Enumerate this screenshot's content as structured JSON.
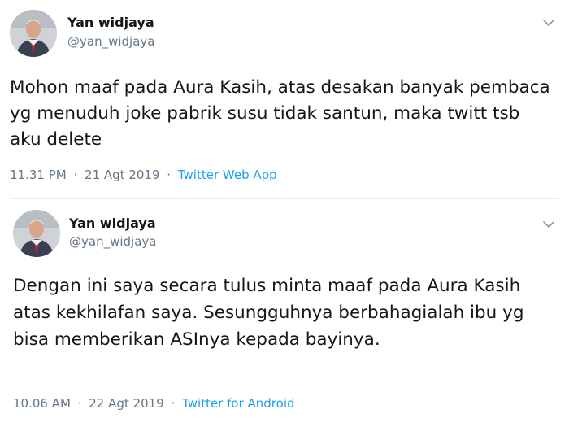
{
  "tweets": [
    {
      "author": {
        "display_name": "Yan widjaya",
        "handle": "@yan_widjaya",
        "avatar_icon": "avatar"
      },
      "menu_icon": "chevron-down-icon",
      "text": "Mohon maaf pada Aura Kasih, atas desakan banyak pembaca yg menuduh joke pabrik susu tidak santun, maka twitt tsb aku delete",
      "time": "11.31 PM",
      "date": "21 Agt 2019",
      "separator": "·",
      "source": "Twitter Web App"
    },
    {
      "author": {
        "display_name": "Yan widjaya",
        "handle": "@yan_widjaya",
        "avatar_icon": "avatar"
      },
      "menu_icon": "chevron-down-icon",
      "text": "Dengan ini saya secara tulus minta maaf pada Aura Kasih atas kekhilafan saya. Sesungguhnya berbahagialah ibu yg bisa memberikan ASInya kepada bayinya.",
      "time": "10.06 AM",
      "date": "22 Agt 2019",
      "separator": "·",
      "source": "Twitter for Android"
    }
  ],
  "colors": {
    "text": "#14171a",
    "secondary": "#657786",
    "link": "#1da1f2",
    "divider": "#e6ecf0"
  }
}
